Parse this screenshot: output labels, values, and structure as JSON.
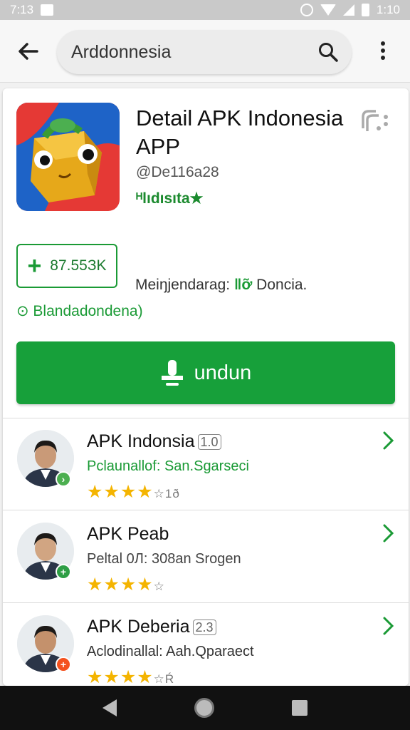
{
  "status_bar": {
    "time_left": "7:13",
    "time_right": "1:10"
  },
  "search": {
    "value": "Arddonnesia"
  },
  "app": {
    "title": "Detail APK Indonesia APP",
    "code": "@De116a28",
    "developer": "ᴴlıdısıtа★",
    "stat": "87.55ЗK",
    "meta": "Meiŋjendarag:",
    "meta_highlight": "‖ỡ",
    "meta_tail": "Doncia.",
    "region": "⊙ Blandadondena)",
    "download_label": "undun"
  },
  "list": [
    {
      "name": "APK Indonsia",
      "tag": "1.0",
      "subtitle": "Pclaunallof: San.Sgarseci",
      "subtitle_color": "#1a9a35",
      "rating": 4,
      "rating_count": "☆1ð",
      "badge": "›",
      "badge_color": "#4caf50"
    },
    {
      "name": "APK Peab",
      "tag": "",
      "subtitle": "Peltal 0Л: 308an Srogen",
      "subtitle_color": "#444444",
      "rating": 4,
      "rating_count": "☆",
      "badge": "+",
      "badge_color": "#2e9e45"
    },
    {
      "name": "APK Deberia",
      "tag": "2.3",
      "subtitle": "Aclodinallal: Aah.Qparaect",
      "subtitle_color": "#333333",
      "rating": 4,
      "rating_count": "☆Ŕ",
      "badge": "+",
      "badge_color": "#f4511e"
    }
  ],
  "icons": {
    "back": "arrow-left-icon",
    "search": "search-icon",
    "menu": "more-vert-icon",
    "share": "share-icon",
    "download": "download-icon",
    "chevron": "chevron-right-icon"
  },
  "colors": {
    "accent": "#17a03a",
    "star": "#f4b400"
  }
}
